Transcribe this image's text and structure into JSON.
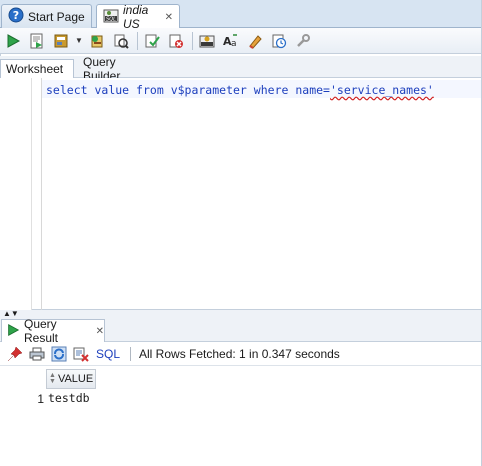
{
  "tabs": [
    {
      "label": "Start Page",
      "icon": "help-circle-icon",
      "active": false
    },
    {
      "label": "india US",
      "icon": "sql-worksheet-icon",
      "active": true,
      "close": "✕"
    }
  ],
  "toolbar": {
    "icons": [
      "run-statement-icon",
      "run-script-icon",
      "autotrace-icon",
      "explain-plan-icon",
      "sql-tuning-icon",
      "commit-icon",
      "rollback-icon",
      "unshared-sql-icon",
      "to-upper-case-icon",
      "clear-icon",
      "sql-history-icon",
      "tools-icon"
    ]
  },
  "worksheet_tabs": [
    {
      "label": "Worksheet",
      "active": true
    },
    {
      "label": "Query Builder",
      "active": false
    }
  ],
  "editor": {
    "sql_keywords": [
      "select",
      "value",
      "from",
      "v$parameter",
      "where",
      "name="
    ],
    "sql_string": "'service_names'",
    "sql_text": "select value from v$parameter where name='service_names'"
  },
  "results": {
    "tab_label": "Query Result",
    "tab_close": "✕",
    "sql_link": "SQL",
    "status": "All Rows Fetched: 1 in 0.347 seconds",
    "columns": [
      "VALUE"
    ],
    "rows": [
      {
        "num": "1",
        "value": "testdb"
      }
    ]
  },
  "colors": {
    "sql_text": "#1d3fbd",
    "spell_error": "#d02020",
    "toolbar_bg": "#e8eef5",
    "tabstrip_bg": "#d7e4f2"
  }
}
